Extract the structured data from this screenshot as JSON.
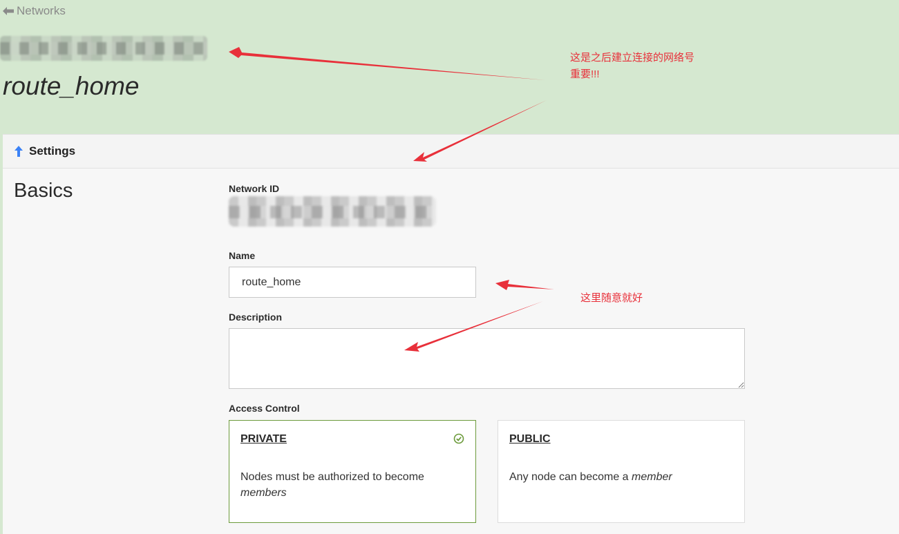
{
  "header": {
    "back_label": "Networks",
    "network_title": "route_home"
  },
  "settings": {
    "title": "Settings",
    "section_title": "Basics",
    "network_id_label": "Network ID",
    "name_label": "Name",
    "name_value": "route_home",
    "description_label": "Description",
    "description_value": "",
    "access_control_label": "Access Control",
    "access_options": [
      {
        "title": "PRIVATE",
        "desc_prefix": "Nodes must be authorized to become ",
        "desc_emph": "members",
        "selected": true
      },
      {
        "title": "PUBLIC",
        "desc_prefix": "Any node can become a ",
        "desc_emph": "member",
        "selected": false
      }
    ]
  },
  "annotations": {
    "note1_line1": "这是之后建立连接的网络号",
    "note1_line2": "重要!!!",
    "note2": "这里随意就好"
  },
  "colors": {
    "page_green": "#d5e8d0",
    "selected_border": "#6b9a3a",
    "annotation_red": "#e8303a",
    "settings_arrow_blue": "#3b82f6"
  }
}
